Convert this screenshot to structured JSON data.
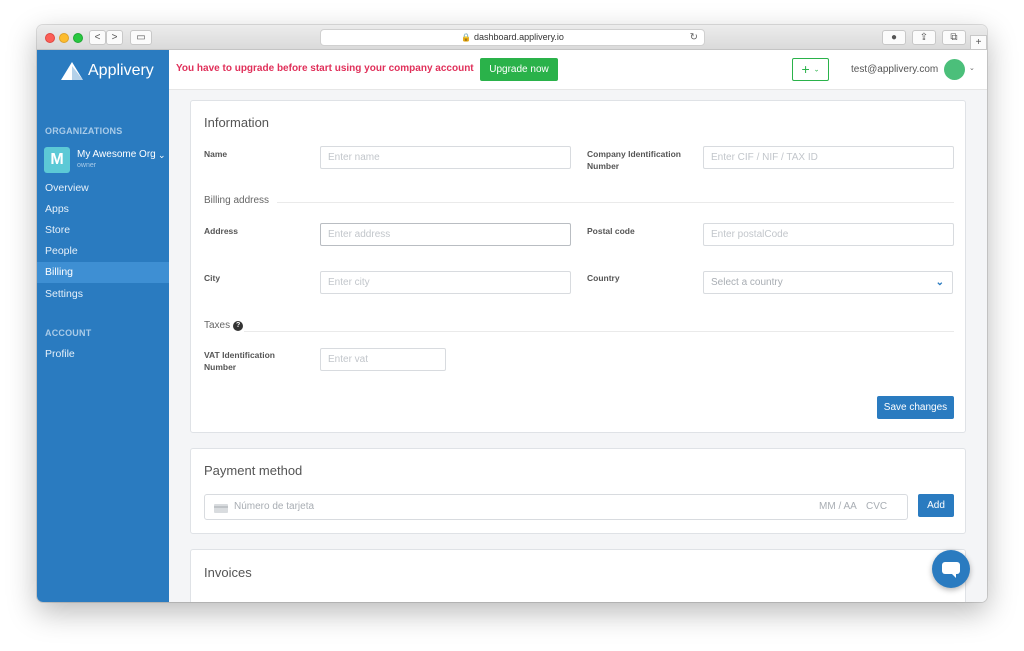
{
  "browser": {
    "url": "dashboard.applivery.io",
    "back_icon": "<",
    "forward_icon": ">",
    "sidebar_icon": "▭",
    "reload_icon": "↻",
    "lock_icon": "🔒",
    "download_icon": "●",
    "share_icon": "⇪",
    "tabs_icon": "⧉",
    "new_tab_icon": "+"
  },
  "brand": {
    "name": "Applivery"
  },
  "sidebar": {
    "organizations_heading": "ORGANIZATIONS",
    "org": {
      "avatar_letter": "M",
      "name": "My Awesome Org",
      "role": "owner",
      "chevron": "⌄"
    },
    "nav": [
      {
        "label": "Overview"
      },
      {
        "label": "Apps"
      },
      {
        "label": "Store"
      },
      {
        "label": "People"
      },
      {
        "label": "Billing"
      },
      {
        "label": "Settings"
      }
    ],
    "account_heading": "ACCOUNT",
    "account_nav": [
      {
        "label": "Profile"
      }
    ]
  },
  "header": {
    "upgrade_message": "You have to upgrade before start using your company account",
    "upgrade_button": "Upgrade now",
    "plus_label": "+",
    "plus_chevron": "⌄",
    "user_email": "test@applivery.com",
    "user_chevron": "⌄"
  },
  "information": {
    "title": "Information",
    "name_label": "Name",
    "name_placeholder": "Enter name",
    "company_id_label": "Company Identification Number",
    "company_id_placeholder": "Enter CIF / NIF / TAX ID",
    "billing_address_title": "Billing address",
    "address_label": "Address",
    "address_placeholder": "Enter address",
    "postal_code_label": "Postal code",
    "postal_code_placeholder": "Enter postalCode",
    "city_label": "City",
    "city_placeholder": "Enter city",
    "country_label": "Country",
    "country_placeholder": "Select a country",
    "country_chevron": "⌄",
    "taxes_title": "Taxes",
    "taxes_help": "?",
    "vat_label": "VAT Identification Number",
    "vat_placeholder": "Enter vat",
    "save_button": "Save changes"
  },
  "payment": {
    "title": "Payment method",
    "card_number_placeholder": "Número de tarjeta",
    "expiry_placeholder": "MM / AA",
    "cvc_placeholder": "CVC",
    "add_button": "Add"
  },
  "invoices": {
    "title": "Invoices"
  },
  "colors": {
    "sidebar": "#2a7bc0",
    "sidebar_active": "#3e8fd3",
    "upgrade_text": "#e0305a",
    "upgrade_button": "#2ab24a",
    "primary_button": "#2a7bc0"
  }
}
